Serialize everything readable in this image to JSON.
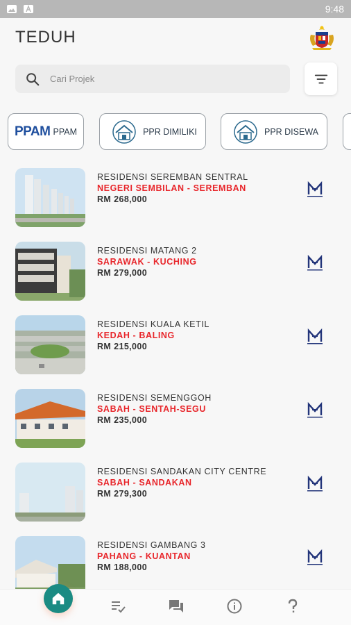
{
  "status_bar": {
    "time": "9:48",
    "icons": [
      "image-icon",
      "font-icon"
    ]
  },
  "header": {
    "title": "TEDUH",
    "crest_icon": "malaysia-crest-icon"
  },
  "search": {
    "placeholder": "Cari Projek",
    "value": ""
  },
  "categories": [
    {
      "label": "PPAM",
      "logo": "ppam-logo"
    },
    {
      "label": "PPR DIMILIKI",
      "logo": "house-icon"
    },
    {
      "label": "PPR DISEWA",
      "logo": "house-icon"
    }
  ],
  "category_logo_texts": {
    "ppam": "PPAM"
  },
  "projects": [
    {
      "name": "RESIDENSI SEREMBAN SENTRAL",
      "location": "NEGERI SEMBILAN - SEREMBAN",
      "price": "RM 268,000"
    },
    {
      "name": "RESIDENSI MATANG 2",
      "location": "SARAWAK - KUCHING",
      "price": "RM 279,000"
    },
    {
      "name": "RESIDENSI KUALA KETIL",
      "location": "KEDAH - BALING",
      "price": "RM 215,000"
    },
    {
      "name": "RESIDENSI SEMENGGOH",
      "location": "SABAH - SENTAH-SEGU",
      "price": "RM 235,000"
    },
    {
      "name": "RESIDENSI SANDAKAN CITY CENTRE",
      "location": "SABAH - SANDAKAN",
      "price": "RM 279,300"
    },
    {
      "name": "RESIDENSI GAMBANG 3",
      "location": "PAHANG - KUANTAN",
      "price": "RM 188,000"
    }
  ],
  "nav": [
    {
      "name": "home",
      "icon": "home-icon",
      "active": true
    },
    {
      "name": "list",
      "icon": "list-check-icon"
    },
    {
      "name": "chat",
      "icon": "chat-icon"
    },
    {
      "name": "info",
      "icon": "info-icon"
    },
    {
      "name": "help",
      "icon": "question-icon"
    }
  ],
  "colors": {
    "accent": "#1b8b83",
    "location": "#e8262b",
    "background": "#f7f7f7"
  }
}
